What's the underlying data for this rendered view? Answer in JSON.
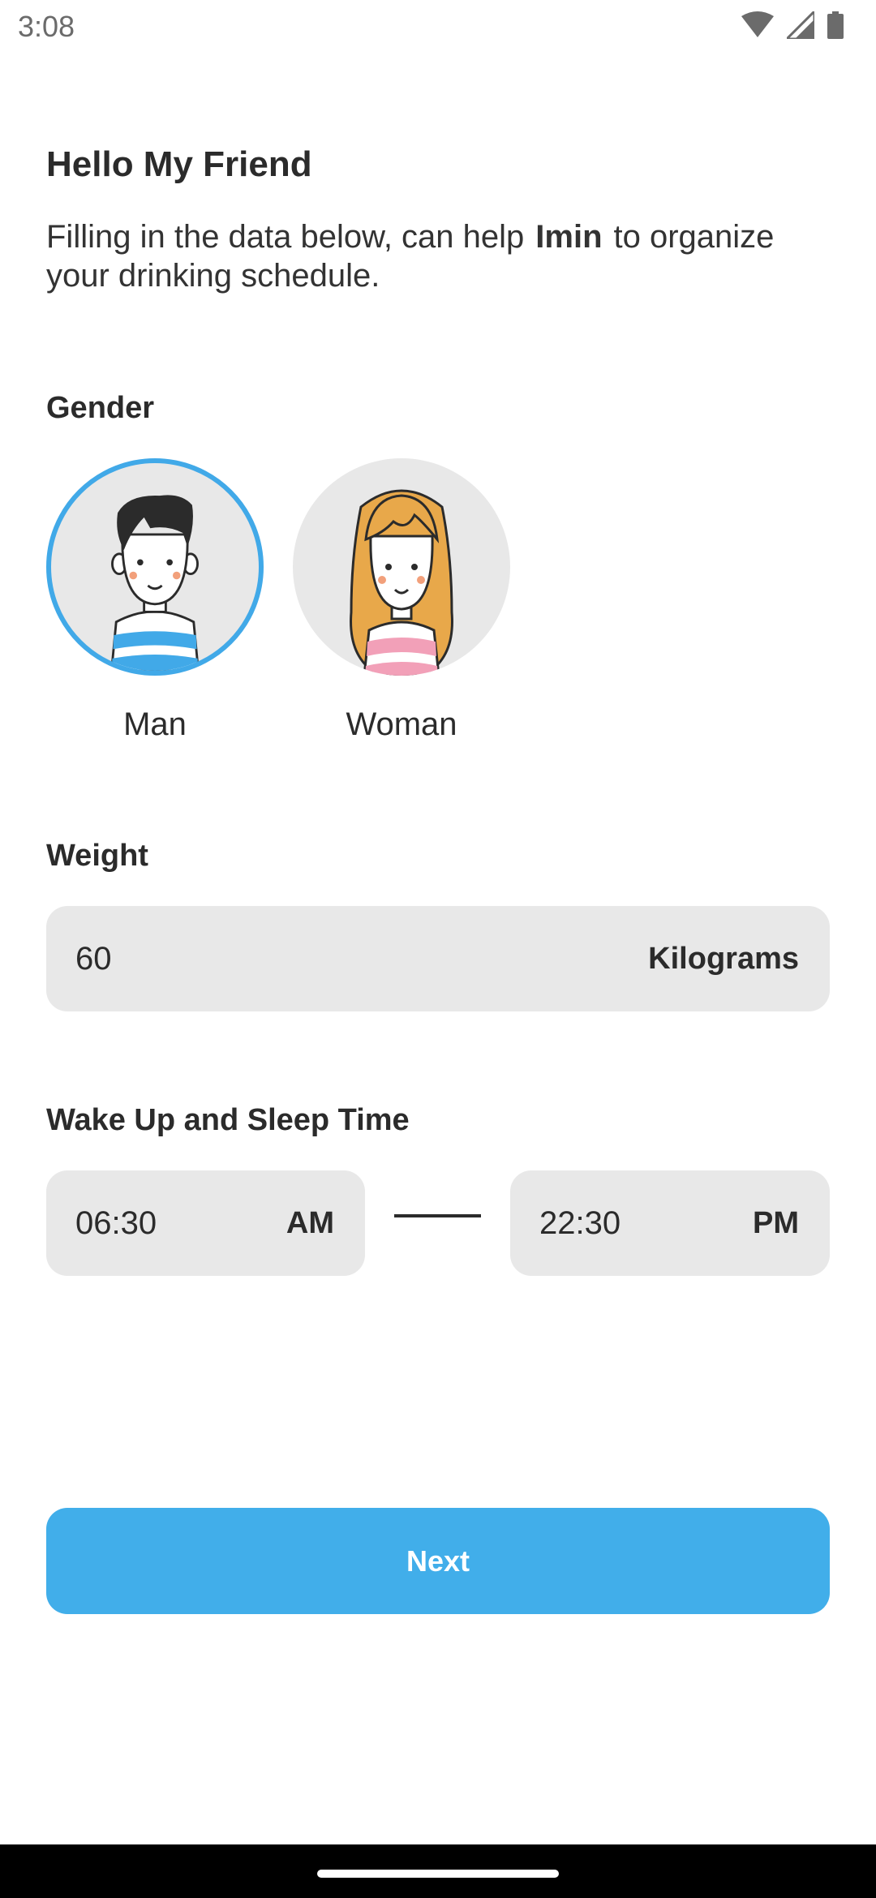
{
  "status_bar": {
    "time": "3:08",
    "icons": [
      "wifi-icon",
      "signal-icon",
      "battery-icon"
    ]
  },
  "header": {
    "title": "Hello My Friend",
    "subtitle_before": "Filling in the data below, can help",
    "brand": "Imin",
    "subtitle_after": "to organize your drinking schedule."
  },
  "gender": {
    "label": "Gender",
    "options": [
      {
        "label": "Man",
        "selected": true
      },
      {
        "label": "Woman",
        "selected": false
      }
    ]
  },
  "weight": {
    "label": "Weight",
    "value": "60",
    "unit": "Kilograms"
  },
  "schedule": {
    "label": "Wake Up and Sleep Time",
    "wake_time": "06:30",
    "wake_period": "AM",
    "sleep_time": "22:30",
    "sleep_period": "PM"
  },
  "actions": {
    "next_label": "Next"
  },
  "colors": {
    "accent": "#41aeea",
    "field_background": "#e8e8e8",
    "text": "#2b2b2b"
  }
}
